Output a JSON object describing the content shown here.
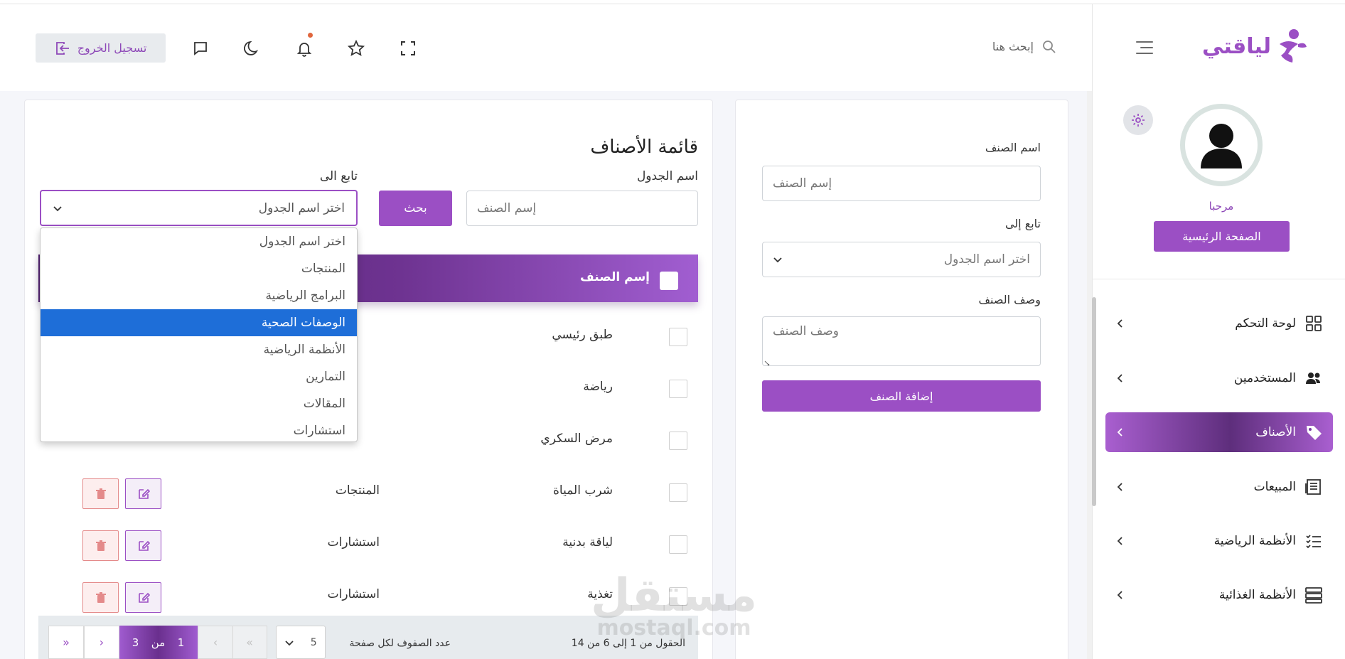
{
  "header": {
    "search_placeholder": "إبحث هنا",
    "logout_label": "تسجيل الخروج"
  },
  "brand": {
    "logo_text": "لياقتي"
  },
  "profile": {
    "welcome": "مرحبا",
    "home_button": "الصفحة الرئيسية"
  },
  "sidebar": {
    "items": [
      {
        "label": "لوحة التحكم",
        "icon": "grid-icon",
        "active": false
      },
      {
        "label": "المستخدمين",
        "icon": "users-icon",
        "active": false
      },
      {
        "label": "الأصناف",
        "icon": "tag-icon",
        "active": true
      },
      {
        "label": "المبيعات",
        "icon": "newspaper-icon",
        "active": false
      },
      {
        "label": "الأنظمة الرياضية",
        "icon": "checklist-icon",
        "active": false
      },
      {
        "label": "الأنظمة الغذائية",
        "icon": "server-icon",
        "active": false
      }
    ]
  },
  "add_form": {
    "name_label": "اسم الصنف",
    "name_placeholder": "إسم الصنف",
    "parent_label": "تابع إلى",
    "parent_value": "اختر اسم الجدول",
    "desc_label": "وصف الصنف",
    "desc_placeholder": "وصف الصنف",
    "submit_label": "إضافة الصنف"
  },
  "list": {
    "title": "قائمة الأصناف",
    "table_name_label": "اسم الجدول",
    "search_placeholder": "إسم الصنف",
    "search_button": "بحث",
    "parent_label": "تابع الى",
    "parent_value": "اختر اسم الجدول",
    "dropdown_options": [
      "اختر اسم الجدول",
      "المنتجات",
      "البرامج الرياضية",
      "الوصفات الصحية",
      "الأنظمة الرياضية",
      "التمارين",
      "المقالات",
      "استشارات"
    ],
    "dropdown_selected": "الوصفات الصحية",
    "column_name": "إسم الصنف",
    "rows": [
      {
        "name": "طبق رئيسي",
        "category": ""
      },
      {
        "name": "رياضة",
        "category": ""
      },
      {
        "name": "مرض السكري",
        "category": ""
      },
      {
        "name": "شرب المياة",
        "category": "المنتجات"
      },
      {
        "name": "لياقة بدنية",
        "category": "استشارات"
      },
      {
        "name": "تغذية",
        "category": "استشارات"
      }
    ]
  },
  "pagination": {
    "info": "الحقول من 1 إلى 6 من 14",
    "per_page_label": "عدد الصفوف لكل صفحة",
    "per_page_value": "5",
    "current_page": "1",
    "of_label": "من",
    "total_pages": "3",
    "first": "«",
    "prev": "‹",
    "next": "›",
    "last": "»"
  },
  "watermark": {
    "main": "مستقل",
    "sub": "mostaql.com"
  },
  "colors": {
    "accent": "#9b4fc4",
    "accent_dark": "#5e2e7c",
    "danger": "#e48a8a",
    "select_blue": "#1e6ed8"
  }
}
